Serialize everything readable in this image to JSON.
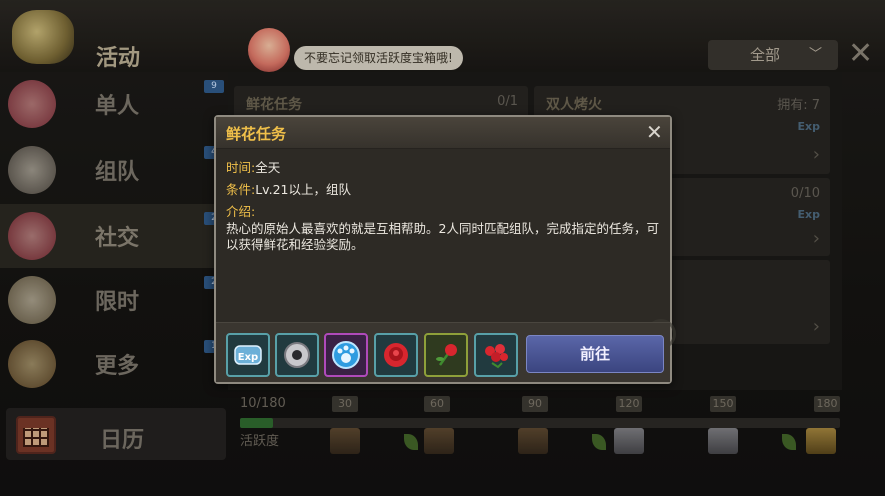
{
  "header": {
    "title": "活动",
    "notice": "不要忘记领取活跃度宝箱哦!",
    "filter_value": "全部"
  },
  "sidebar": {
    "items": [
      {
        "label": "单人",
        "badge": "9"
      },
      {
        "label": "组队",
        "badge": "4"
      },
      {
        "label": "社交",
        "badge": "2"
      },
      {
        "label": "限时",
        "badge": "2"
      },
      {
        "label": "更多",
        "badge": "1"
      }
    ],
    "calendar_label": "日历"
  },
  "cards": [
    {
      "name": "鲜花任务",
      "progress": "0/1"
    },
    {
      "name": "双人烤火",
      "progress": "拥有: 7",
      "exp": "Exp"
    },
    {
      "name": "",
      "progress": "0/10",
      "exp": "Exp"
    }
  ],
  "activity": {
    "value_text": "10/180",
    "label": "活跃度",
    "current": 10,
    "max": 180,
    "milestones": [
      30,
      60,
      90,
      120,
      150,
      180
    ]
  },
  "dialog": {
    "title": "鲜花任务",
    "time_key": "时间:",
    "time_val": "全天",
    "cond_key": "条件:",
    "cond_val": "Lv.21以上，组队",
    "intro_key": "介绍:",
    "desc": "热心的原始人最喜欢的就是互相帮助。2人同时匹配组队，完成指定的任务，可以获得鲜花和经验奖励。",
    "rewards": [
      {
        "icon": "exp-icon",
        "text": "Exp"
      },
      {
        "icon": "gear-nut-icon"
      },
      {
        "icon": "paw-token-icon"
      },
      {
        "icon": "rose-icon"
      },
      {
        "icon": "rose-stem-icon"
      },
      {
        "icon": "rose-bouquet-icon"
      }
    ],
    "go_label": "前往"
  }
}
